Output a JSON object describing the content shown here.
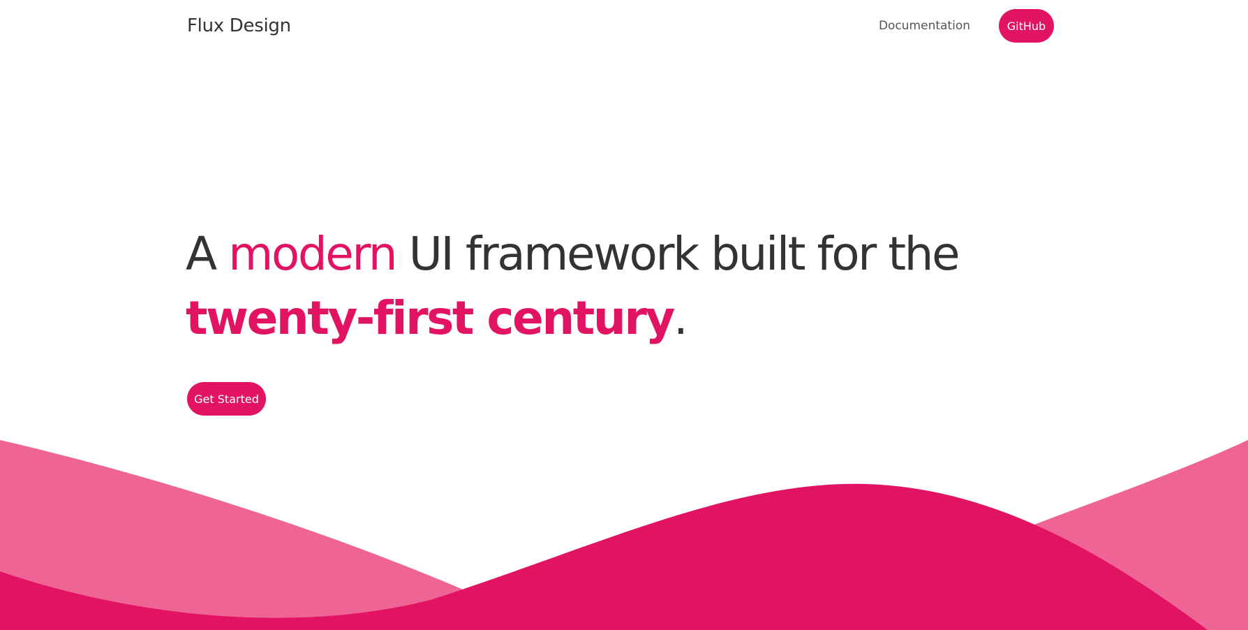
{
  "navbar": {
    "brand": "Flux Design",
    "documentation_link": "Documentation",
    "github_button": "GitHub"
  },
  "hero": {
    "headline": {
      "part1": "A ",
      "highlight1": "modern",
      "part2": " UI framework built for the",
      "highlight2": "twenty-first century",
      "end": "."
    },
    "cta_button": "Get Started"
  },
  "colors": {
    "accent": "#e31363",
    "accent_light": "#ee6595",
    "text": "#333333",
    "background": "#ffffff"
  }
}
